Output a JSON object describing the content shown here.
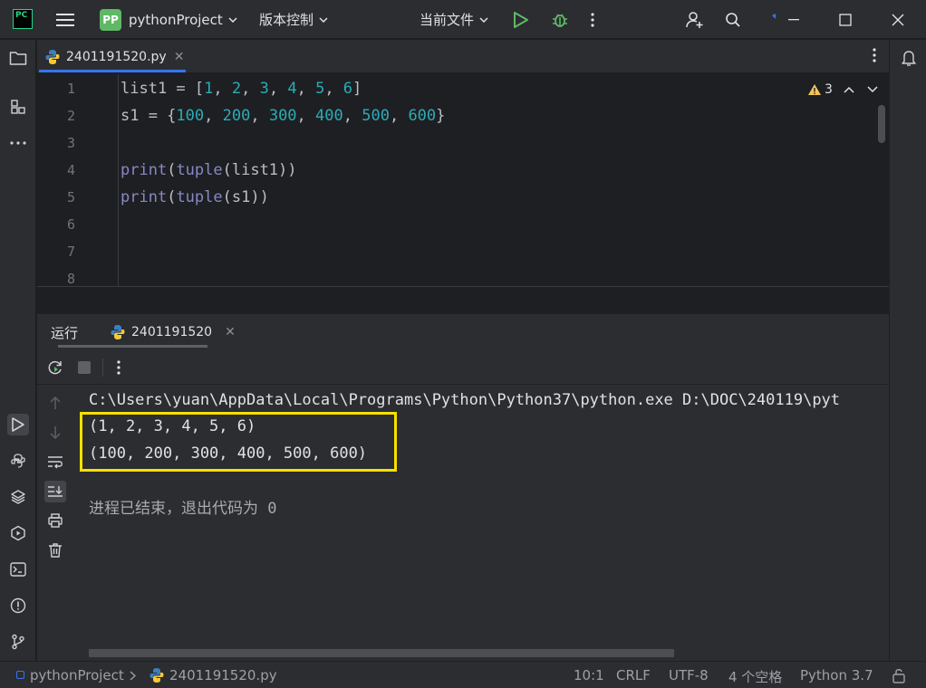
{
  "titlebar": {
    "app_logo_text": "PC",
    "project_badge": "PP",
    "project_name": "pythonProject",
    "vcs_label": "版本控制",
    "run_config": "当前文件"
  },
  "editor_tab": {
    "label": "2401191520.py"
  },
  "editor": {
    "line_numbers": [
      "1",
      "2",
      "3",
      "4",
      "5",
      "6",
      "7",
      "8"
    ],
    "warning_count": "3",
    "lines": [
      [
        [
          "id",
          "list1 = ["
        ],
        [
          "num",
          "1"
        ],
        [
          "id",
          ", "
        ],
        [
          "num",
          "2"
        ],
        [
          "id",
          ", "
        ],
        [
          "num",
          "3"
        ],
        [
          "id",
          ", "
        ],
        [
          "num",
          "4"
        ],
        [
          "id",
          ", "
        ],
        [
          "num",
          "5"
        ],
        [
          "id",
          ", "
        ],
        [
          "num",
          "6"
        ],
        [
          "id",
          "]"
        ]
      ],
      [
        [
          "id",
          "s1 = {"
        ],
        [
          "num",
          "100"
        ],
        [
          "id",
          ", "
        ],
        [
          "num",
          "200"
        ],
        [
          "id",
          ", "
        ],
        [
          "num",
          "300"
        ],
        [
          "id",
          ", "
        ],
        [
          "num",
          "400"
        ],
        [
          "id",
          ", "
        ],
        [
          "num",
          "500"
        ],
        [
          "id",
          ", "
        ],
        [
          "num",
          "600"
        ],
        [
          "id",
          "}"
        ]
      ],
      [],
      [
        [
          "fn",
          "print"
        ],
        [
          "id",
          "("
        ],
        [
          "fn",
          "tuple"
        ],
        [
          "id",
          "(list1))"
        ]
      ],
      [
        [
          "fn",
          "print"
        ],
        [
          "id",
          "("
        ],
        [
          "fn",
          "tuple"
        ],
        [
          "id",
          "(s1))"
        ]
      ],
      [],
      [],
      []
    ]
  },
  "run_panel": {
    "title": "运行",
    "tab_label": "2401191520"
  },
  "console": {
    "command": "C:\\Users\\yuan\\AppData\\Local\\Programs\\Python\\Python37\\python.exe D:\\DOC\\240119\\pyt",
    "output_1": "(1, 2, 3, 4, 5, 6)",
    "output_2": "(100, 200, 300, 400, 500, 600)",
    "exit_message": "进程已结束，退出代码为 0"
  },
  "statusbar": {
    "project": "pythonProject",
    "file": "2401191520.py",
    "position": "10:1",
    "line_sep": "CRLF",
    "encoding": "UTF-8",
    "indent": "4 个空格",
    "interpreter": "Python 3.7"
  },
  "colors": {
    "accent": "#3574f0",
    "run_green": "#5fb865",
    "highlight_yellow": "#f6e000",
    "number": "#2aacb8",
    "builtin": "#8888c6"
  }
}
